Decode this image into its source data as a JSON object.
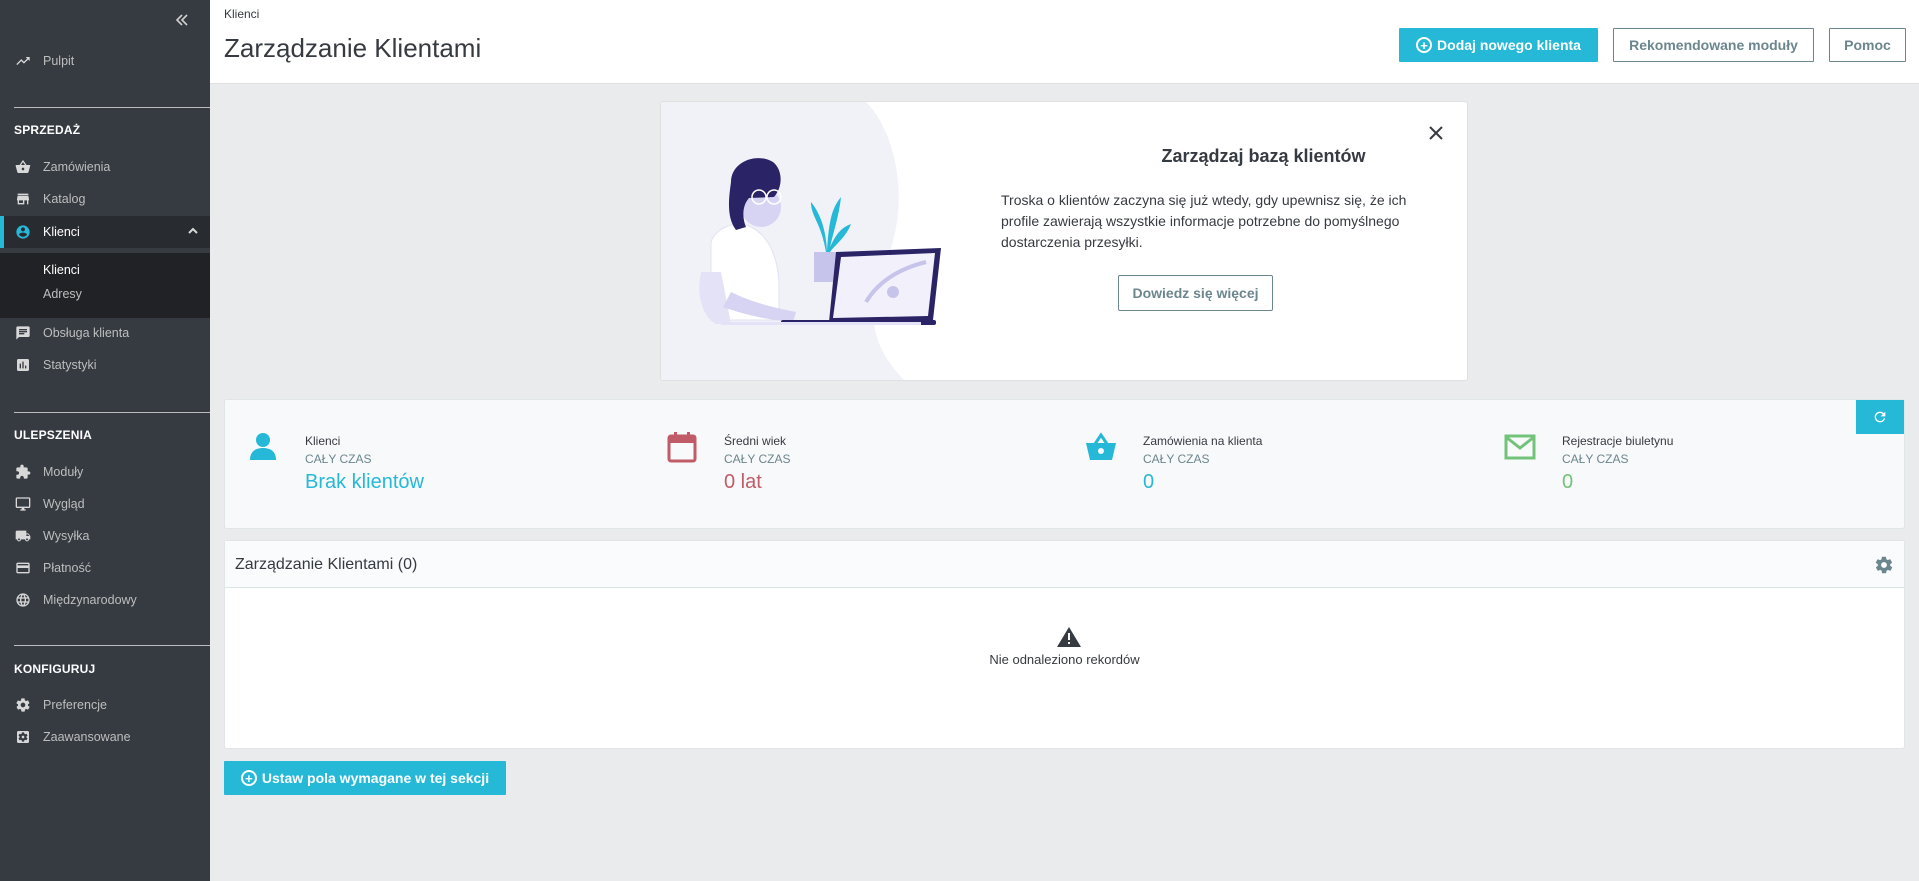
{
  "sidebar": {
    "collapse_label": "«",
    "dashboard": {
      "label": "Pulpit",
      "icon": "trending-up-icon"
    },
    "sections": [
      {
        "title": "SPRZEDAŻ"
      },
      {
        "title": "ULEPSZENIA"
      },
      {
        "title": "KONFIGURUJ"
      }
    ],
    "sales_items": [
      {
        "label": "Zamówienia",
        "icon": "basket-icon"
      },
      {
        "label": "Katalog",
        "icon": "store-icon"
      },
      {
        "label": "Klienci",
        "icon": "account-circle-icon"
      },
      {
        "label": "Obsługa klienta",
        "icon": "chat-icon"
      },
      {
        "label": "Statystyki",
        "icon": "bar-chart-icon"
      }
    ],
    "customers_sub": [
      {
        "label": "Klienci"
      },
      {
        "label": "Adresy"
      }
    ],
    "improve_items": [
      {
        "label": "Moduły",
        "icon": "puzzle-icon"
      },
      {
        "label": "Wygląd",
        "icon": "desktop-icon"
      },
      {
        "label": "Wysyłka",
        "icon": "truck-icon"
      },
      {
        "label": "Płatność",
        "icon": "credit-card-icon"
      },
      {
        "label": "Międzynarodowy",
        "icon": "globe-icon"
      }
    ],
    "config_items": [
      {
        "label": "Preferencje",
        "icon": "gear-icon"
      },
      {
        "label": "Zaawansowane",
        "icon": "settings-applications-icon"
      }
    ]
  },
  "header": {
    "breadcrumb": "Klienci",
    "title": "Zarządzanie Klientami",
    "add_button": "Dodaj nowego klienta",
    "recommended_button": "Rekomendowane moduły",
    "help_button": "Pomoc"
  },
  "onboarding": {
    "title": "Zarządzaj bazą klientów",
    "text": "Troska o klientów zaczyna się już wtedy, gdy upewnisz się, że ich profile zawierają wszystkie informacje potrzebne do pomyślnego dostarczenia przesyłki.",
    "button": "Dowiedz się więcej"
  },
  "kpis": [
    {
      "label": "Klienci",
      "sub": "CAŁY CZAS",
      "value": "Brak klientów",
      "color": "#25b9d7",
      "icon": "person-icon"
    },
    {
      "label": "Średni wiek",
      "sub": "CAŁY CZAS",
      "value": "0 lat",
      "color": "#c05c67",
      "icon": "calendar-icon"
    },
    {
      "label": "Zamówienia na klienta",
      "sub": "CAŁY CZAS",
      "value": "0",
      "color": "#25b9d7",
      "icon": "basket-icon"
    },
    {
      "label": "Rejestracje biuletynu",
      "sub": "CAŁY CZAS",
      "value": "0",
      "color": "#72c279",
      "icon": "envelope-icon"
    }
  ],
  "table": {
    "title": "Zarządzanie Klientami (0)",
    "empty_text": "Nie odnaleziono rekordów"
  },
  "required_fields_button": "Ustaw pola wymagane w tej sekcji",
  "colors": {
    "accent": "#25b9d7",
    "sidebar_bg": "#363a41"
  }
}
